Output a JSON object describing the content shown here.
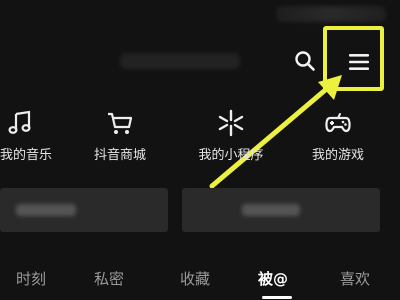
{
  "header": {
    "search_icon": "search-icon",
    "menu_icon": "hamburger-menu-icon"
  },
  "shortcuts": [
    {
      "label": "我的音乐",
      "icon": "music-note-icon"
    },
    {
      "label": "抖音商城",
      "icon": "shopping-cart-icon"
    },
    {
      "label": "我的小程序",
      "icon": "mini-program-icon"
    },
    {
      "label": "我的游戏",
      "icon": "game-controller-icon"
    }
  ],
  "tabs": [
    {
      "label": "时刻"
    },
    {
      "label": "私密"
    },
    {
      "label": "收藏"
    },
    {
      "label": "被@",
      "active": true
    },
    {
      "label": "喜欢"
    }
  ],
  "annotation": {
    "highlight_color": "#ecf13d"
  },
  "colors": {
    "background": "#121212",
    "text": "#e6e6e6",
    "inactive_tab": "#9a9a9a"
  }
}
